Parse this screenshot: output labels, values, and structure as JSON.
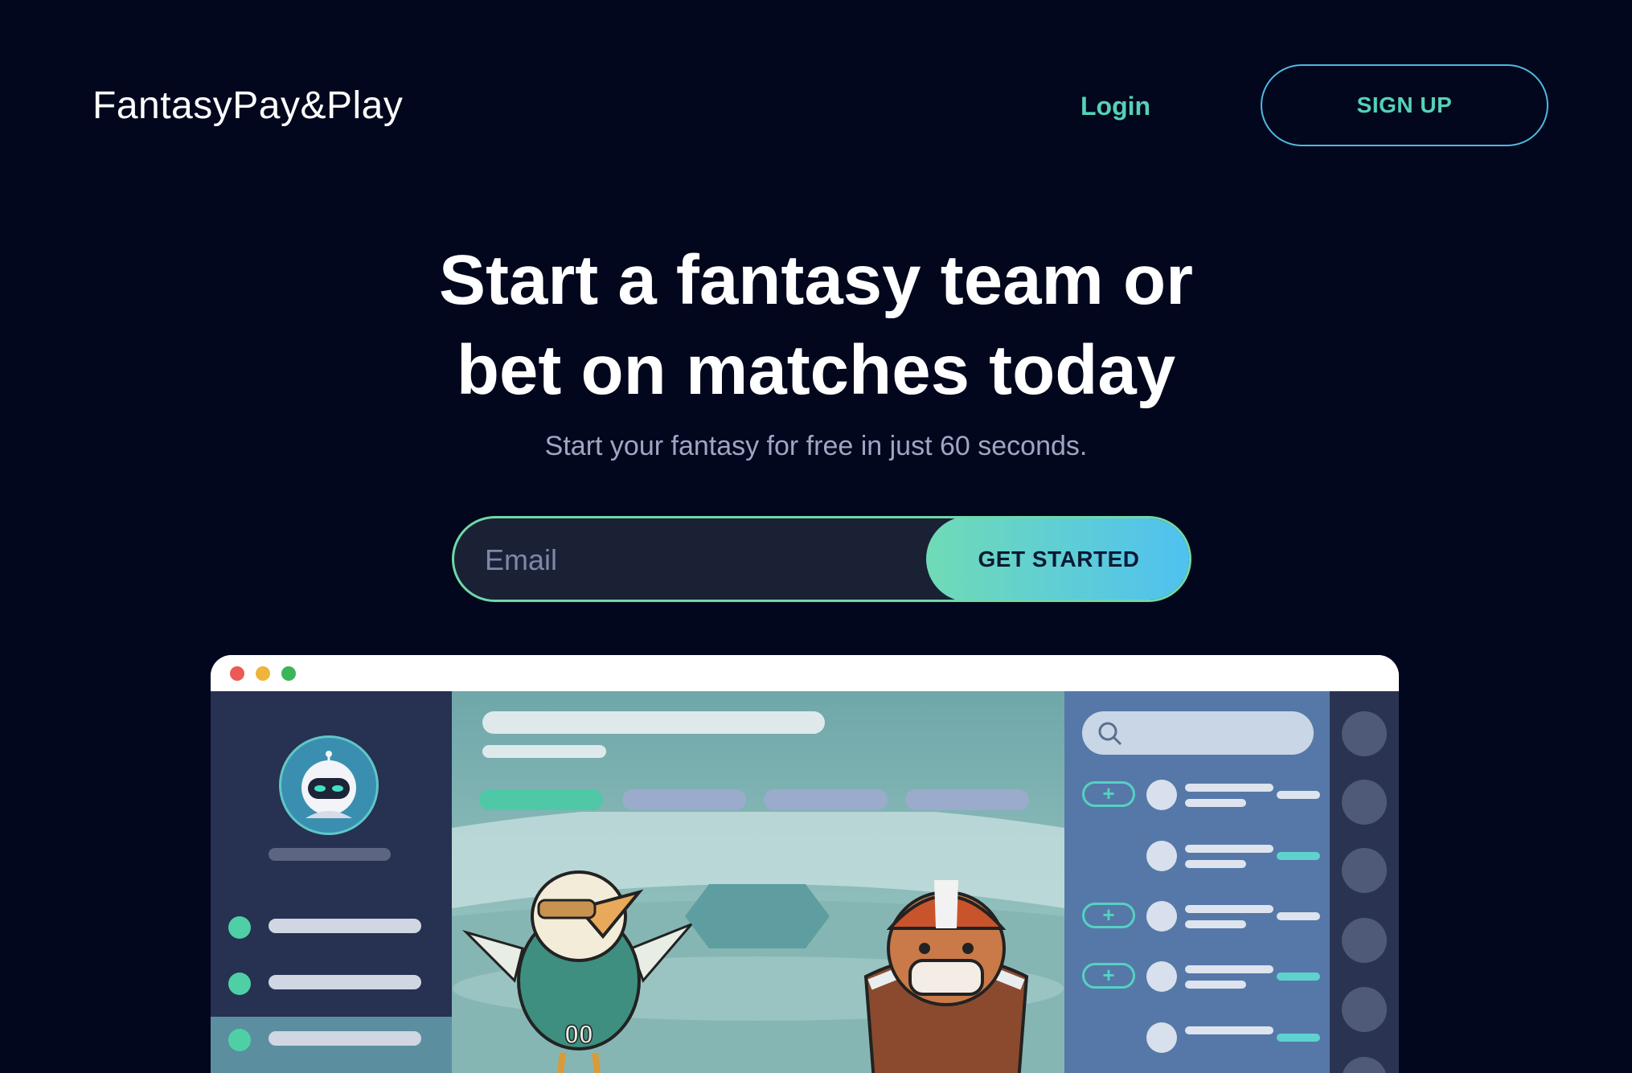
{
  "header": {
    "brand": "FantasyPay&Play",
    "login_label": "Login",
    "signup_label": "SIGN UP"
  },
  "hero": {
    "headline_line1": "Start a fantasy team or",
    "headline_line2": "bet on matches today",
    "subheadline": "Start your fantasy for free in just 60 seconds.",
    "email_placeholder": "Email",
    "email_value": "",
    "cta_label": "GET STARTED"
  },
  "colors": {
    "background": "#02071d",
    "accent": "#55d1b7",
    "gradient_start": "#70dbb6",
    "gradient_end": "#4fc1f1"
  },
  "mockup": {
    "icons": [
      "search-icon",
      "plus-icon",
      "robot-avatar-icon",
      "eagle-mascot",
      "bulldog-mascot"
    ],
    "mascot_jersey": "00"
  }
}
